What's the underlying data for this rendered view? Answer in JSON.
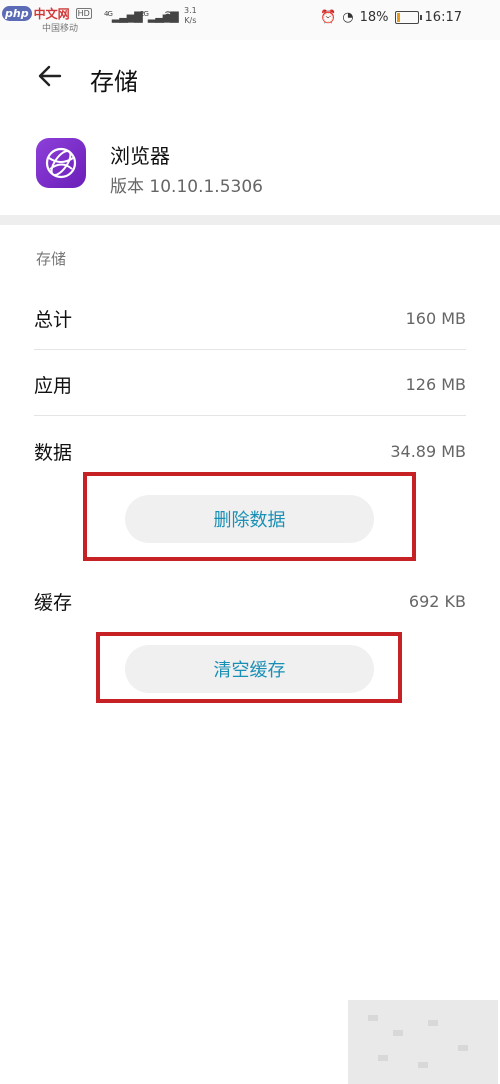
{
  "status": {
    "watermark_php": "php",
    "watermark_site": "中文网",
    "hd": "HD",
    "carrier": "中国移动",
    "net1": "4G",
    "net2": "2G",
    "speed_value": "3.1",
    "speed_unit": "K/s",
    "battery_text": "18%",
    "time": "16:17",
    "battery_level": 0.18,
    "battery_color": "#e89a1e"
  },
  "header": {
    "title": "存储"
  },
  "app": {
    "name": "浏览器",
    "version": "版本 10.10.1.5306",
    "icon": "browser-globe-icon"
  },
  "storage": {
    "section_title": "存储",
    "rows": [
      {
        "label": "总计",
        "value": "160 MB"
      },
      {
        "label": "应用",
        "value": "126 MB"
      },
      {
        "label": "数据",
        "value": "34.89 MB"
      }
    ],
    "clear_data_label": "删除数据",
    "cache_label": "缓存",
    "cache_value": "692 KB",
    "clear_cache_label": "清空缓存"
  },
  "colors": {
    "accent": "#1a8fb5",
    "highlight": "#c62226",
    "app_icon": "#7a2ed0"
  }
}
